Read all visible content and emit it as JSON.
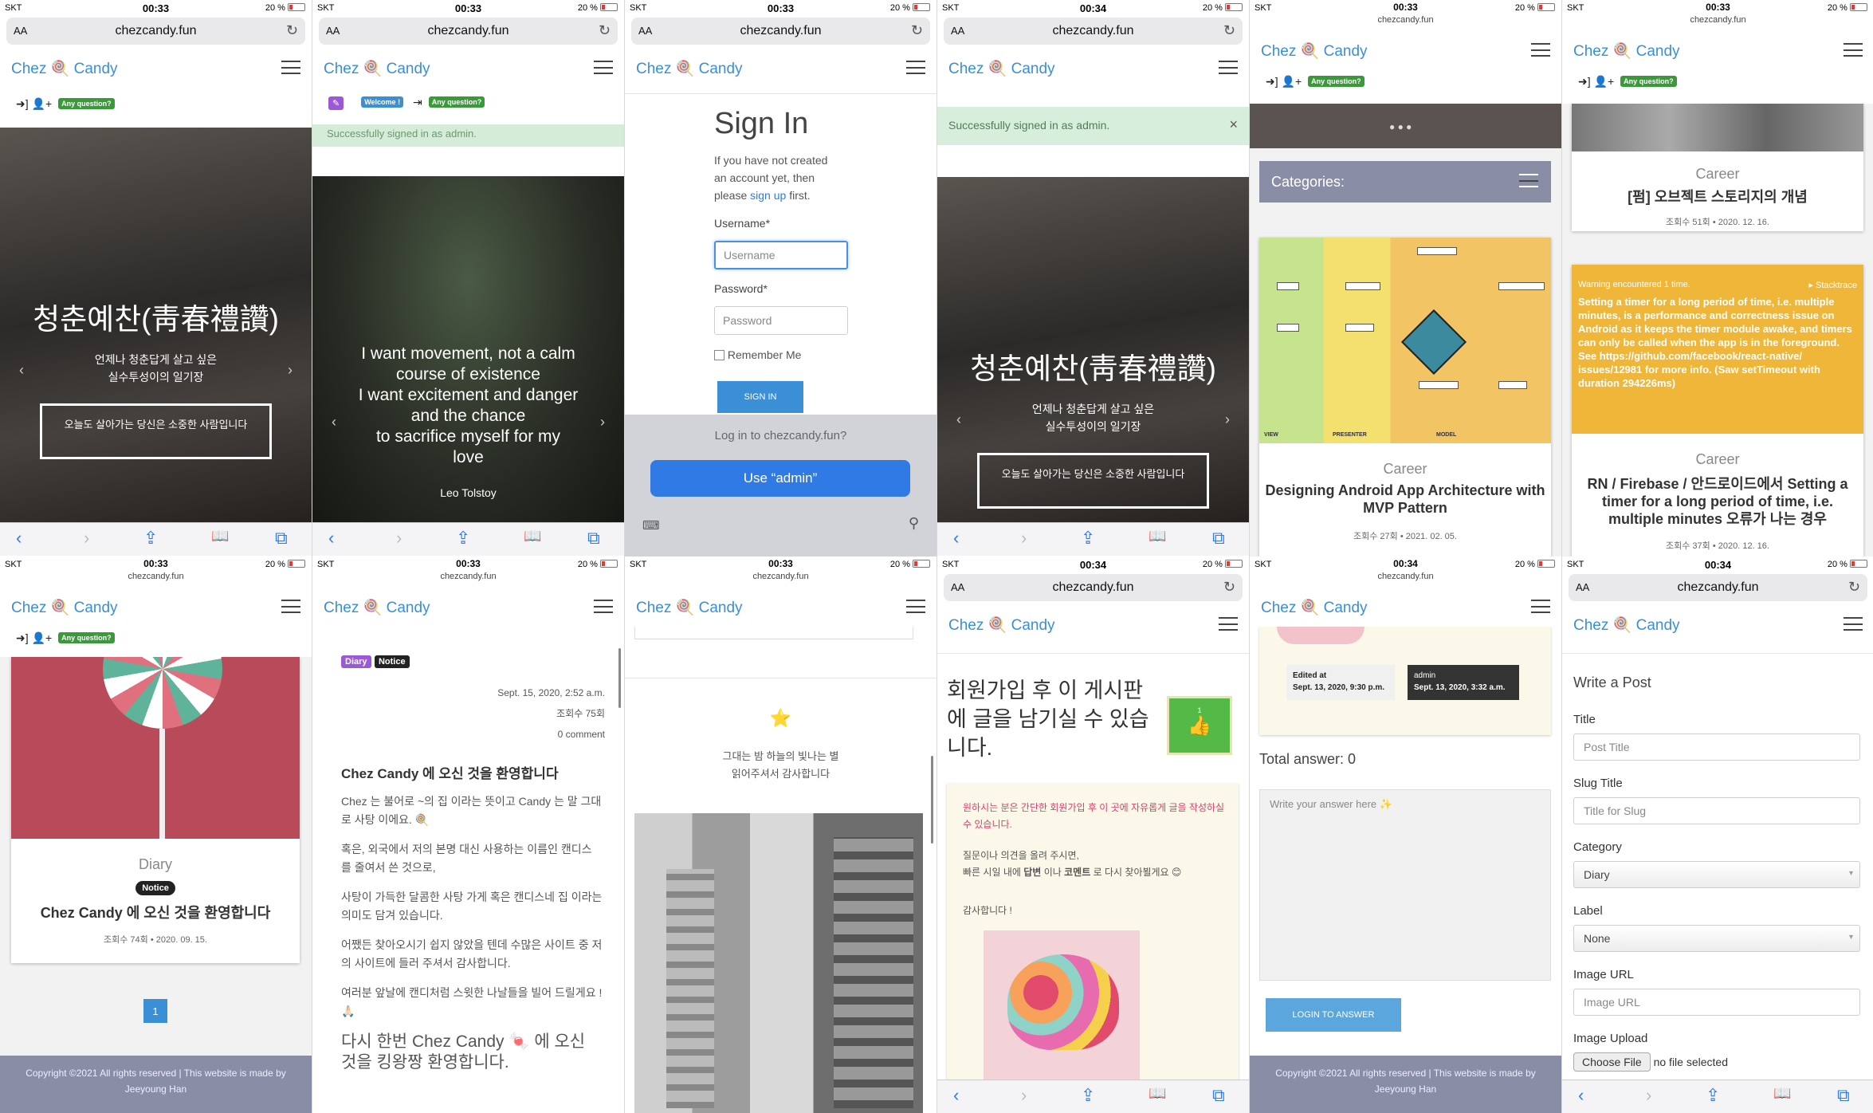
{
  "status": {
    "carrier": "SKT",
    "time1": "00:33",
    "time2": "00:34",
    "battery": "20 %"
  },
  "browser": {
    "aa": "AA",
    "domain": "chezcandy.fun",
    "reload": "↻"
  },
  "brand": {
    "left": "Chez",
    "icon": "🍭",
    "right": "Candy"
  },
  "nav": {
    "any_question": "Any question?",
    "welcome": "Welcome !"
  },
  "toolbar": {
    "back": "‹",
    "fwd": "›",
    "share": "⇪",
    "book": "📖",
    "tabs": "⧉"
  },
  "hero": {
    "title": "청춘예찬(靑春禮讚)",
    "sub1": "언제나 청춘답게 살고 싶은",
    "sub2": "실수투성이의 일기장",
    "button": "오늘도 살아가는 당신은 소중한 사람입니다"
  },
  "quote": {
    "line1": "I want movement, not a calm",
    "line2": "course of existence",
    "line3": "I want excitement and danger",
    "line4": "and the chance",
    "line5": "to sacrifice myself for my",
    "line6": "love",
    "author": "Leo Tolstoy",
    "alert": "Successfully signed in as admin."
  },
  "signin": {
    "title": "Sign In",
    "intro1": "If you have not created",
    "intro2": "an account yet, then",
    "intro3a": "please",
    "intro3link": "sign up",
    "intro3b": "first.",
    "username_label": "Username*",
    "username_ph": "Username",
    "password_label": "Password*",
    "password_ph": "Password",
    "remember": "Remember Me",
    "submit": "SIGN IN",
    "prompt": "Log in to chezcandy.fun?",
    "use_admin": "Use “admin”"
  },
  "alert": {
    "text": "Successfully signed in as admin.",
    "close": "×"
  },
  "categories": {
    "label": "Categories:"
  },
  "post_mvp": {
    "category": "Career",
    "title": "Designing Android App Architecture with MVP Pattern",
    "meta": "조회수 27회 • 2021. 02. 05.",
    "diagram": {
      "v1": "VIEW",
      "v2": "PRESENTER",
      "v3": "MODEL"
    }
  },
  "post_stack": {
    "category": "Career",
    "title": "[펌] 오브젝트 스토리지의 개념",
    "meta": "조회수 51회 • 2020. 12. 16.",
    "warn_head": "Warning encountered 1 time.",
    "warn_side": "▸ Stacktrace",
    "warn_body": "Setting a timer for a long period of time, i.e. multiple minutes, is a performance and correctness issue on Android as it keeps the timer module awake, and timers can only be called when the app is in the foreground. See https://github.com/facebook/react-native/ issues/12981 for more info. (Saw setTimeout with duration 294226ms)",
    "category2": "Career",
    "title2": "RN / Firebase / 안드로이드에서 Setting a timer for a long period of time, i.e. multiple minutes 오류가 나는 경우",
    "meta2": "조회수 37회 • 2020. 12. 16."
  },
  "post_diary": {
    "category": "Diary",
    "badge": "Notice",
    "title": "Chez Candy 에 오신 것을 환영합니다",
    "meta": "조회수 74회 • 2020. 09. 15.",
    "page": "1"
  },
  "footer": {
    "line1": "Copyright ©2021 All rights reserved | This website is made by",
    "line2": "Jeeyoung Han"
  },
  "detail": {
    "badge1": "Diary",
    "badge2": "Notice",
    "date": "Sept. 15, 2020, 2:52 a.m.",
    "views": "조회수 75회",
    "comments": "0 comment",
    "heading": "Chez Candy 에 오신 것을 환영합니다",
    "p1": "Chez 는 불어로 ~의 집 이라는 뜻이고 Candy 는 말 그대로 사탕 이에요. 🍭",
    "p2": "혹은, 외국에서 저의 본명 대신 사용하는 이름인 캔디스 를 줄여서 쓴 것으로,",
    "p3": "사탕이 가득한 달콤한 사탕 가게 혹은 캔디스네 집 이라는 의미도 담겨 있습니다.",
    "p4": "어쨌든 찾아오시기 쉽지 않았을 텐데 수많은 사이트 중 저의 사이트에 들러 주셔서 감사합니다.",
    "p5": "여러분 앞날에 캔디처럼 스윗한 나날들을 빌어 드릴게요 ! 🙏🏻",
    "p6": "다시 한번 Chez Candy 🍬 에 오신 것을 킹왕짱 환영합니다."
  },
  "star": {
    "icon": "⭐",
    "line1": "그대는 밤 하늘의 빛나는 별",
    "line2": "읽어주셔서 감사합니다"
  },
  "board": {
    "heading": "회원가입 후 이 게시판에 글을 남기실 수 있습니다.",
    "likes": "1",
    "note1": "원하시는 분은 간단한 회원가입 후 이 곳에 자유롭게 글을 작성하실 수 있습니다.",
    "note2": "질문이나 의견을 올려 주시면,",
    "note3a": "빠른 시일 내에",
    "note3b": "답변",
    "note3c": "이나",
    "note3d": "코멘트",
    "note3e": "로 다시 찾아뵐게요 😊",
    "note4": "감사합니다 !"
  },
  "answer": {
    "edited_label": "Edited at",
    "edited_val": "Sept. 13, 2020, 9:30 p.m.",
    "author": "admin",
    "author_date": "Sept. 13, 2020, 3:32 a.m.",
    "total": "Total answer: 0",
    "placeholder": "Write your answer here ✨",
    "button": "LOGIN TO ANSWER"
  },
  "write": {
    "heading": "Write a Post",
    "title_label": "Title",
    "title_ph": "Post Title",
    "slug_label": "Slug Title",
    "slug_ph": "Title for Slug",
    "category_label": "Category",
    "category_val": "Diary",
    "label_label": "Label",
    "label_val": "None",
    "image_url_label": "Image URL",
    "image_url_ph": "Image URL",
    "upload_label": "Image Upload",
    "choose": "Choose File",
    "no_file": "no file selected"
  }
}
